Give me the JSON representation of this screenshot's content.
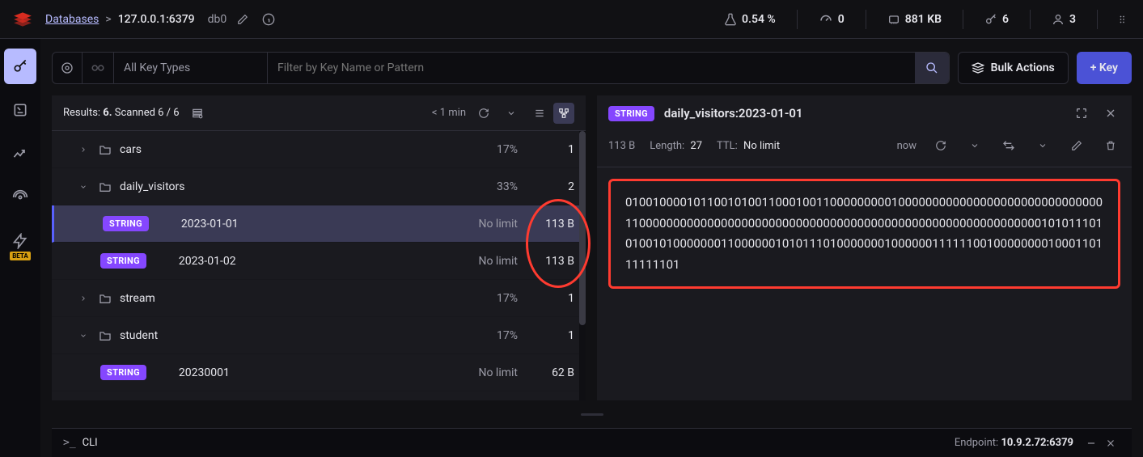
{
  "breadcrumb": {
    "databases": "Databases",
    "host": "127.0.0.1:6379",
    "db": "db0"
  },
  "metrics": {
    "cpu": "0.54 %",
    "ops": "0",
    "memory": "881 KB",
    "keys": "6",
    "clients": "3"
  },
  "filter": {
    "all_types": "All Key Types",
    "placeholder": "Filter by Key Name or Pattern"
  },
  "buttons": {
    "bulk": "Bulk Actions",
    "add_key": "+ Key"
  },
  "results": {
    "label": "Results: ",
    "count": "6.",
    "scanned": " Scanned 6 / 6",
    "time": "< 1 min"
  },
  "badge": {
    "string": "STRING"
  },
  "tree": {
    "cars": {
      "name": "cars",
      "pct": "17%",
      "count": "1"
    },
    "daily_visitors": {
      "name": "daily_visitors",
      "pct": "33%",
      "count": "2"
    },
    "dv1": {
      "name": "2023-01-01",
      "ttl": "No limit",
      "size": "113 B"
    },
    "dv2": {
      "name": "2023-01-02",
      "ttl": "No limit",
      "size": "113 B"
    },
    "stream": {
      "name": "stream",
      "pct": "17%",
      "count": "1"
    },
    "student": {
      "name": "student",
      "pct": "17%",
      "count": "1"
    },
    "st1": {
      "name": "20230001",
      "ttl": "No limit",
      "size": "62 B"
    }
  },
  "detail": {
    "key_name": "daily_visitors:2023-01-01",
    "size": "113 B",
    "length_label": "Length:",
    "length": "27",
    "ttl_label": "TTL:",
    "ttl": "No limit",
    "refresh": "now",
    "value": "01001000010110010100110001001100000000010000000000000000000000000000001100000000000000000000000000000000000000000000000000000000000101011101010010100000001100000010101110100000001000000111111001000000001000110111111101"
  },
  "cli": {
    "label": "CLI",
    "endpoint_label": "Endpoint:  ",
    "endpoint": "10.9.2.72:6379"
  }
}
